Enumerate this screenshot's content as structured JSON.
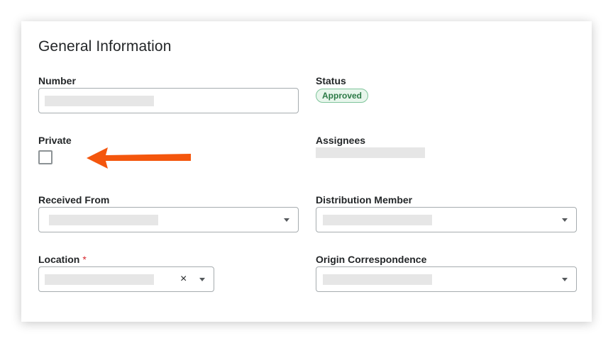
{
  "section": {
    "title": "General Information"
  },
  "fields": {
    "number": {
      "label": "Number"
    },
    "status": {
      "label": "Status",
      "value": "Approved"
    },
    "private": {
      "label": "Private",
      "checked": false
    },
    "assignees": {
      "label": "Assignees"
    },
    "received_from": {
      "label": "Received From"
    },
    "distribution_member": {
      "label": "Distribution Member"
    },
    "location": {
      "label": "Location",
      "required_marker": "*",
      "clear_icon": "×"
    },
    "origin_correspondence": {
      "label": "Origin Correspondence"
    }
  },
  "annotation": {
    "arrow_color": "#f4560d",
    "points_to": "private-checkbox"
  },
  "colors": {
    "status_badge_bg": "#e8f6ec",
    "status_badge_text": "#2c7a46",
    "required": "#d7282f"
  }
}
